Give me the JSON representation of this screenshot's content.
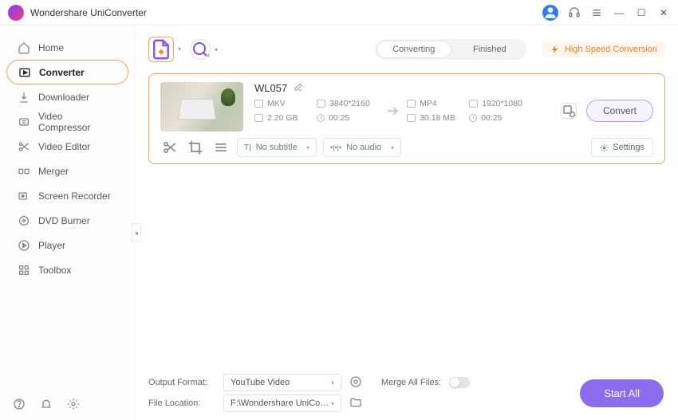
{
  "app": {
    "title": "Wondershare UniConverter"
  },
  "sidebar": {
    "items": [
      {
        "label": "Home"
      },
      {
        "label": "Converter"
      },
      {
        "label": "Downloader"
      },
      {
        "label": "Video Compressor"
      },
      {
        "label": "Video Editor"
      },
      {
        "label": "Merger"
      },
      {
        "label": "Screen Recorder"
      },
      {
        "label": "DVD Burner"
      },
      {
        "label": "Player"
      },
      {
        "label": "Toolbox"
      }
    ]
  },
  "tabs": {
    "converting": "Converting",
    "finished": "Finished"
  },
  "hsc_label": "High Speed Conversion",
  "file": {
    "name": "WL057",
    "src": {
      "format": "MKV",
      "resolution": "3840*2160",
      "size": "2.20 GB",
      "duration": "00:25"
    },
    "dst": {
      "format": "MP4",
      "resolution": "1920*1080",
      "size": "30.18 MB",
      "duration": "00:25"
    },
    "subtitle": "No subtitle",
    "audio": "No audio",
    "settings_label": "Settings",
    "convert_label": "Convert"
  },
  "bottom": {
    "output_format_label": "Output Format:",
    "output_format_value": "YouTube Video",
    "file_location_label": "File Location:",
    "file_location_value": "F:\\Wondershare UniConverter",
    "merge_label": "Merge All Files:",
    "start_all": "Start All"
  }
}
